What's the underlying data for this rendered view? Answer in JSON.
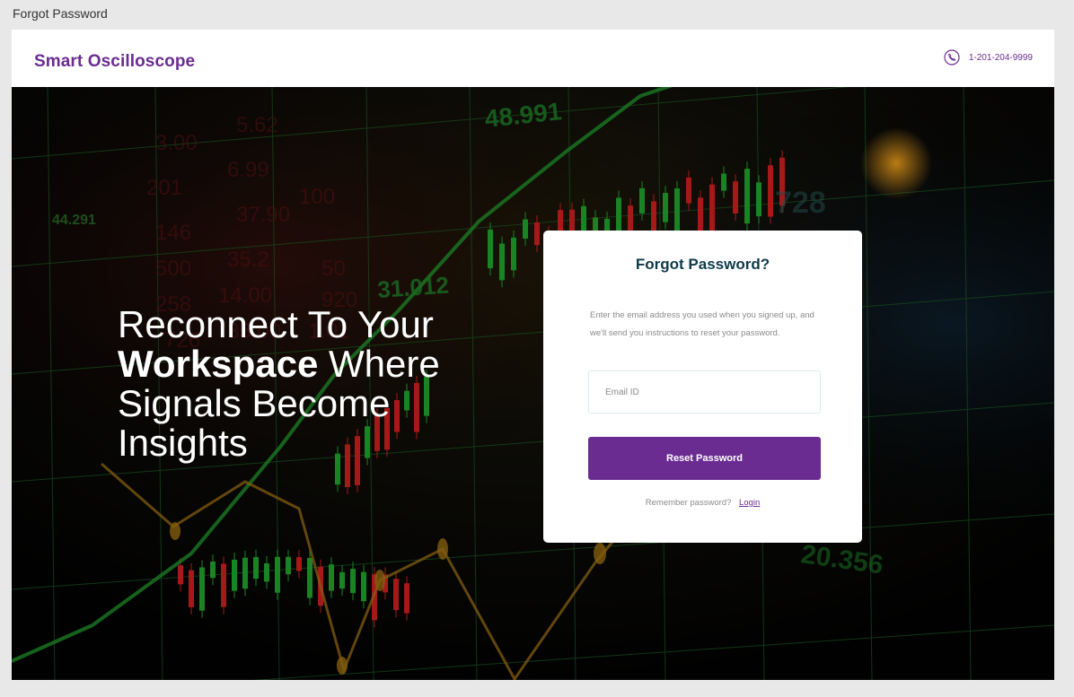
{
  "frame": {
    "title": "Forgot Password"
  },
  "header": {
    "brand": "Smart Oscilloscope",
    "phone": "1-201-204-9999",
    "phone_icon": "phone-icon"
  },
  "hero": {
    "headline_line1": "Reconnect To Your",
    "headline_bold": "Workspace",
    "headline_rest": "Where",
    "headline_line3": "Signals Become",
    "headline_line4": "Insights",
    "bg_numbers": [
      "48.991",
      "44.291",
      "31.012",
      "728",
      "20.356"
    ]
  },
  "card": {
    "title": "Forgot Password?",
    "description": "Enter the email address you used when you signed up, and we'll send you instructions to reset your password.",
    "email_placeholder": "Email ID",
    "reset_label": "Reset Password",
    "remember_text": "Remember password?",
    "login_label": "Login"
  },
  "colors": {
    "brand": "#6a2c91",
    "card_title": "#0f3a4a",
    "page_bg": "#e8e8e8"
  }
}
